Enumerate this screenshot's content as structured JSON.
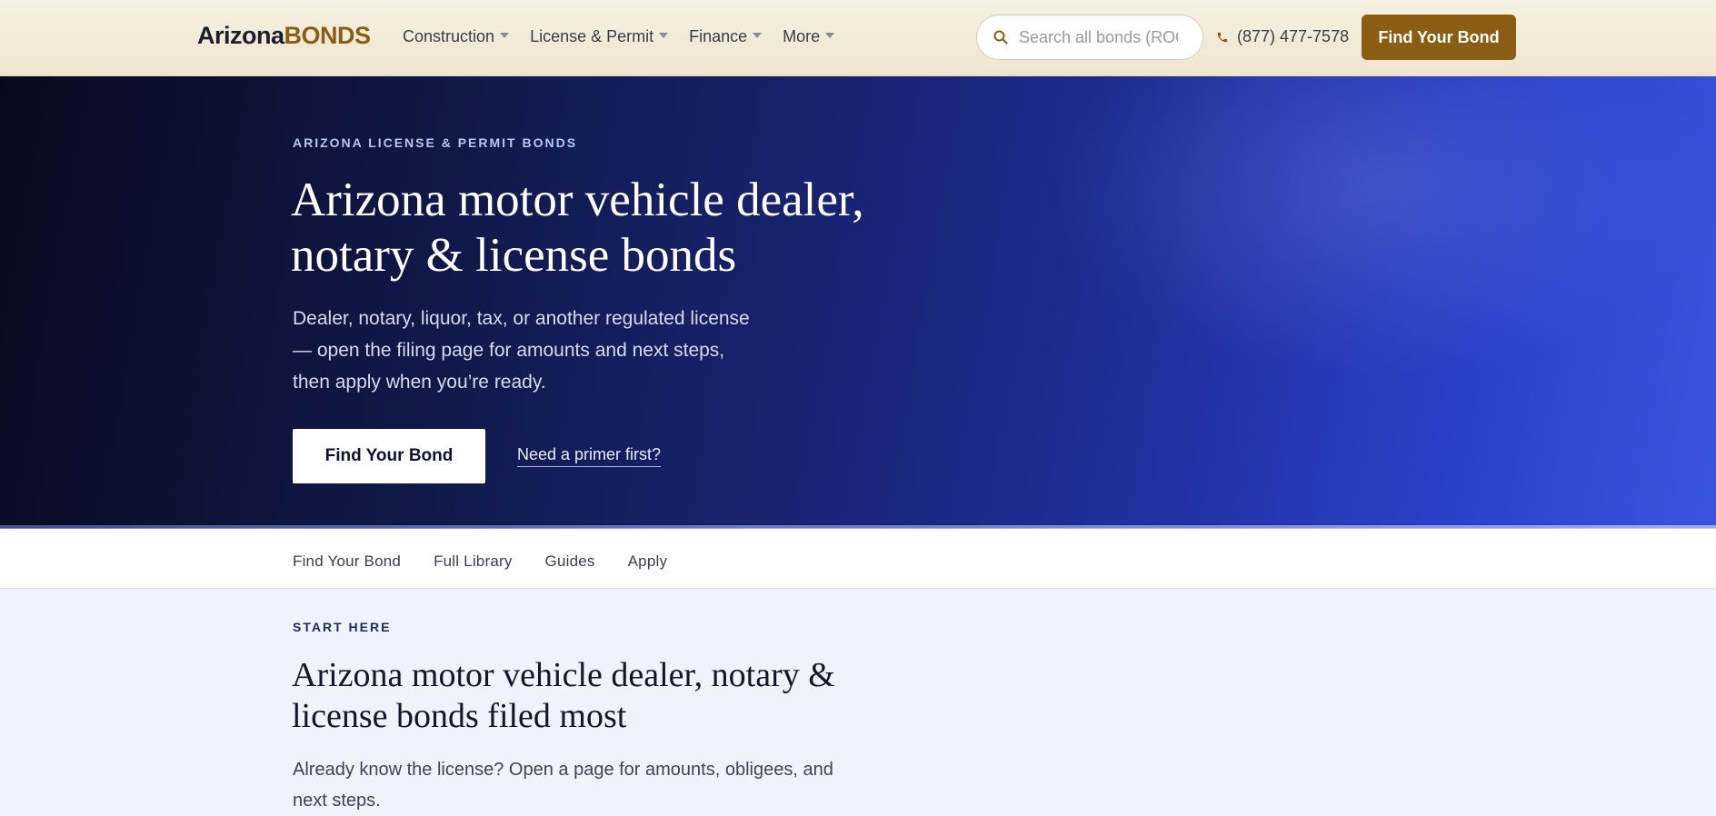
{
  "header": {
    "logo_primary": "Arizona",
    "logo_accent": "BONDS",
    "nav": [
      {
        "label": "Construction"
      },
      {
        "label": "License & Permit"
      },
      {
        "label": "Finance"
      },
      {
        "label": "More"
      }
    ],
    "search_placeholder": "Search all bonds (ROC",
    "phone": "(877) 477-7578",
    "cta_label": "Find Your Bond"
  },
  "hero": {
    "eyebrow": "ARIZONA LICENSE & PERMIT BONDS",
    "title": "Arizona motor vehicle dealer, notary & license bonds",
    "subtitle": "Dealer, notary, liquor, tax, or another regulated license — open the filing page for amounts and next steps, then apply when you’re ready.",
    "primary_button": "Find Your Bond",
    "secondary_link": "Need a primer first?"
  },
  "subnav": {
    "items": [
      {
        "label": "Find Your Bond"
      },
      {
        "label": "Full Library"
      },
      {
        "label": "Guides"
      },
      {
        "label": "Apply"
      }
    ]
  },
  "section": {
    "eyebrow": "START HERE",
    "title": "Arizona motor vehicle dealer, notary & license bonds filed most",
    "subtitle": "Already know the license? Open a page for amounts, obligees, and next steps."
  },
  "colors": {
    "brand_gold": "#8a5d12",
    "hero_dark": "#070a1f",
    "hero_blue": "#3a55e0",
    "page_bg": "#eff3fb"
  }
}
